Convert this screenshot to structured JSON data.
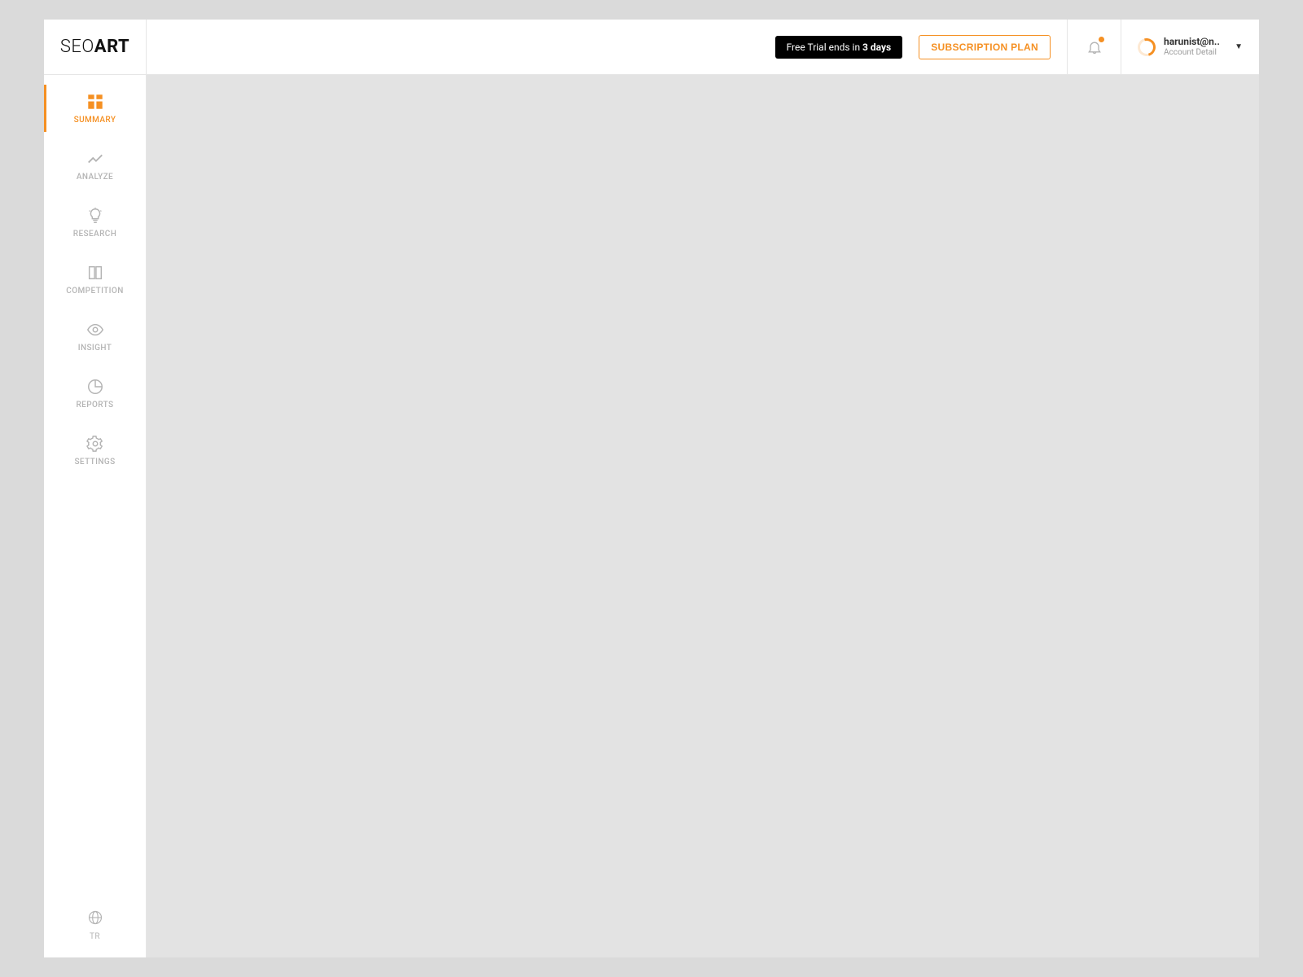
{
  "brand": {
    "part1": "SEO",
    "part2": "ART"
  },
  "header": {
    "trial_prefix": "Free Trial ends in ",
    "trial_days": "3 days",
    "subscription_label": "SUBSCRIPTION PLAN",
    "account_name": "harunist@n..",
    "account_sub": "Account Detail"
  },
  "sidebar": {
    "items": [
      {
        "label": "SUMMARY"
      },
      {
        "label": "ANALYZE"
      },
      {
        "label": "RESEARCH"
      },
      {
        "label": "COMPETITION"
      },
      {
        "label": "INSIGHT"
      },
      {
        "label": "REPORTS"
      },
      {
        "label": "SETTINGS"
      }
    ],
    "language_label": "TR"
  },
  "colors": {
    "accent": "#f59023",
    "page_bg": "#dadada",
    "content_bg": "#e3e3e3",
    "sidebar_inactive": "#b4b4b4"
  }
}
